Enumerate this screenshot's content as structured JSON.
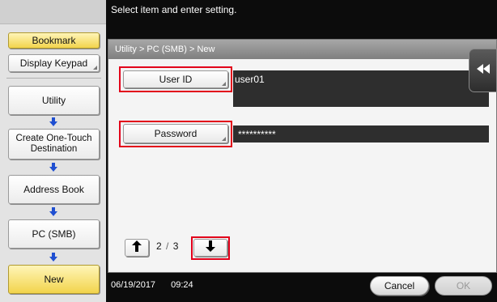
{
  "instruction": "Select item and enter setting.",
  "sidebar": {
    "bookmark": "Bookmark",
    "display_keypad": "Display Keypad",
    "steps": [
      {
        "label": "Utility"
      },
      {
        "label": "Create One-Touch Destination"
      },
      {
        "label": "Address Book"
      },
      {
        "label": "PC (SMB)"
      },
      {
        "label": "New"
      }
    ]
  },
  "panel": {
    "breadcrumb": "Utility > PC (SMB) > New",
    "user_id": {
      "label": "User ID",
      "value": "user01"
    },
    "password": {
      "label": "Password",
      "value": "**********"
    }
  },
  "pager": {
    "current": "2",
    "separator": "/",
    "total": "3"
  },
  "footer": {
    "date": "06/19/2017",
    "time": "09:24"
  },
  "buttons": {
    "cancel": "Cancel",
    "ok": "OK"
  },
  "colors": {
    "highlight": "#e2001a",
    "bookmark_gold": "#f2d44c",
    "arrow_blue": "#1f4fd1"
  },
  "icons": {
    "back": "double-left-arrow-icon",
    "page_up": "arrow-up-icon",
    "page_down": "arrow-down-icon",
    "flow": "arrow-down-icon"
  }
}
